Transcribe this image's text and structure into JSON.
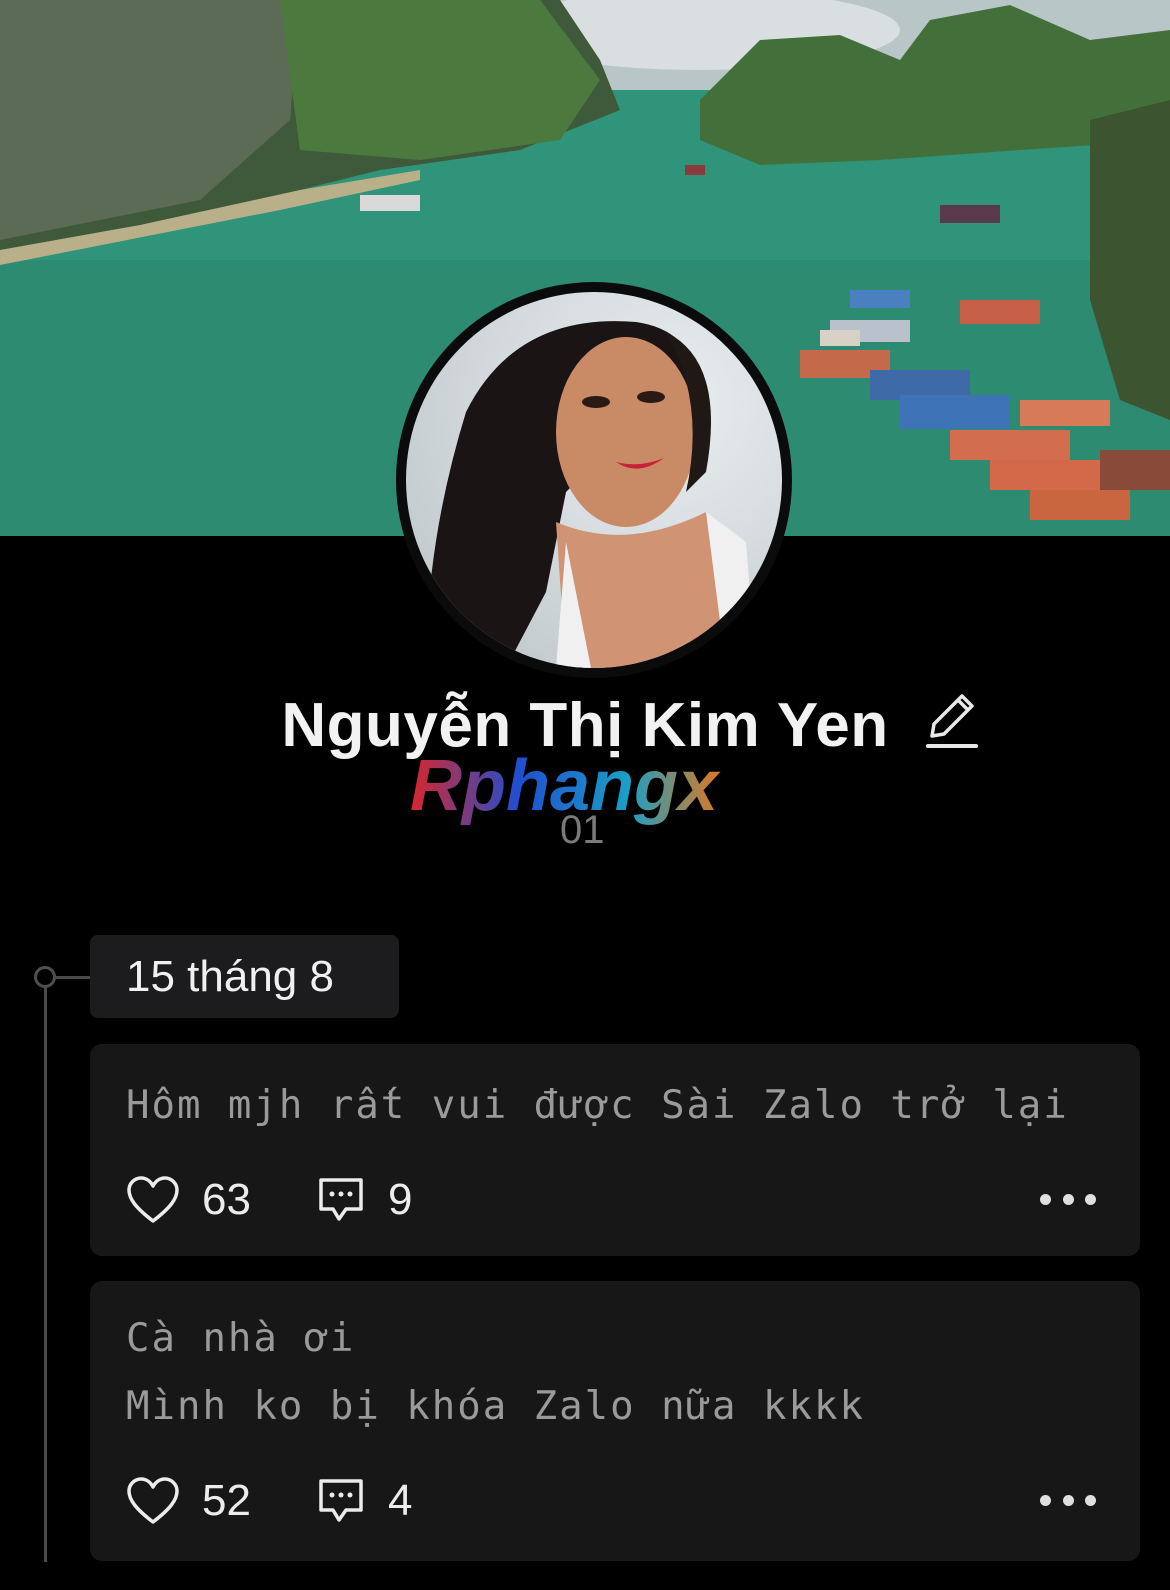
{
  "profile": {
    "name": "Nguyễn Thị Kim Yen",
    "watermark": "Rphangx",
    "sub_label": "01"
  },
  "timeline": {
    "date": "15 tháng 8",
    "posts": [
      {
        "text": "Hôm mjh rất vui được Sài Zalo trở lại",
        "likes": "63",
        "comments": "9"
      },
      {
        "text_line1": "Cà nhà ơi",
        "text_line2": "Mình ko bị khóa Zalo nữa kkkk",
        "likes": "52",
        "comments": "4"
      }
    ]
  },
  "icons": [
    "heart-icon",
    "comment-icon",
    "more-icon",
    "edit-icon"
  ]
}
